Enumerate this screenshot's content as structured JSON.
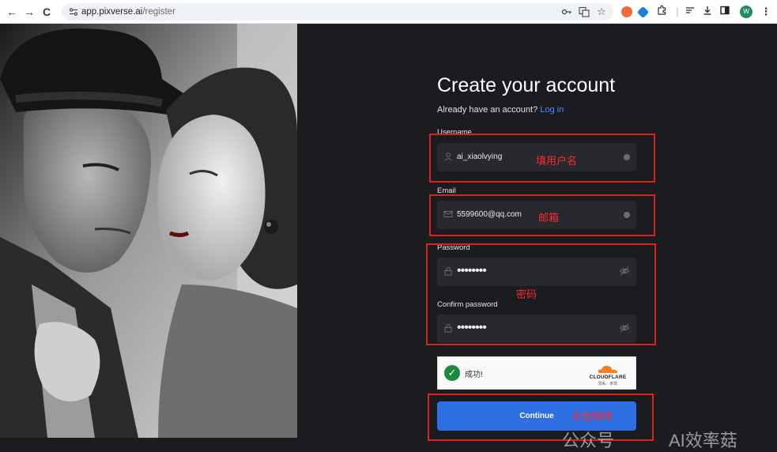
{
  "browser": {
    "back": "←",
    "forward": "→",
    "reload": "C",
    "site_icon": "site-info-icon",
    "url_host": "app.pixverse.ai",
    "url_path": "/register",
    "avatar_letter": "W"
  },
  "form": {
    "title": "Create your account",
    "subtitle": "Already have an account?",
    "login_link": "Log in",
    "username_label": "Username",
    "username_value": "ai_xiaolvying",
    "email_label": "Email",
    "email_value": "5599600@qq.com",
    "password_label": "Password",
    "password_value": "••••••••",
    "confirm_label": "Confirm password",
    "confirm_value": "••••••••",
    "continue_label": "Continue"
  },
  "captcha": {
    "status": "成功!",
    "brand": "CLOUDFLARE",
    "links": "隐私 · 条款"
  },
  "annotations": {
    "username_note": "填用户名",
    "email_note": "邮箱",
    "password_note": "密码",
    "continue_note": "点击继续"
  },
  "watermark": {
    "left": "公众号",
    "right": "AI效率菇"
  },
  "colors": {
    "panel_bg": "#1b1c20",
    "field_bg": "#28292f",
    "primary": "#2f6fe4",
    "link": "#4d90fe",
    "annotation": "#e02020",
    "success": "#1c8a3c"
  }
}
